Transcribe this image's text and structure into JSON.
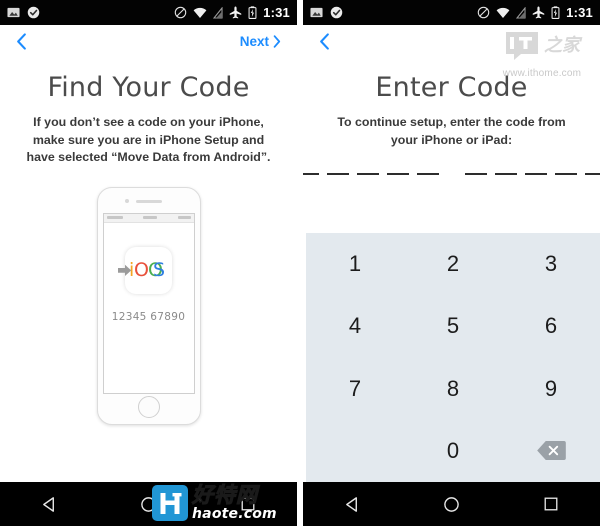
{
  "statusbar": {
    "time": "1:31",
    "icons_left": [
      "image-icon",
      "check-badge-icon"
    ],
    "icons_right": [
      "do-not-disturb-icon",
      "wifi-icon",
      "signal-off-icon",
      "airplane-mode-icon",
      "battery-icon"
    ]
  },
  "left_panel": {
    "nav": {
      "back_icon": "chevron-left-icon",
      "next_label": "Next",
      "next_icon": "chevron-right-icon"
    },
    "title": "Find Your Code",
    "subtitle": "If you don’t see a code on your iPhone, make sure you are in iPhone Setup and have selected “Move Data from Android”.",
    "phone": {
      "app_icon_label": "iOS",
      "arrow_icon": "right-arrow-icon",
      "code": "12345 67890"
    }
  },
  "right_panel": {
    "nav": {
      "back_icon": "chevron-left-icon"
    },
    "title": "Enter Code",
    "subtitle": "To continue setup, enter the code from your iPhone or iPad:",
    "code_field": {
      "group_one_slots": 5,
      "group_two_slots": 5,
      "entered_value": ""
    },
    "keypad": {
      "keys": [
        "1",
        "2",
        "3",
        "4",
        "5",
        "6",
        "7",
        "8",
        "9",
        "",
        "0",
        "delete"
      ],
      "delete_icon": "backspace-icon",
      "background_color": "#e3e9ee"
    }
  },
  "navbar": {
    "back_icon": "triangle-back-icon",
    "home_icon": "circle-home-icon",
    "recents_icon": "square-recents-icon"
  },
  "watermarks": {
    "ithome": {
      "logo_text": "IT",
      "logo_cn": "之家",
      "url": "www.ithome.com"
    },
    "haote": {
      "logo_letter": "H",
      "cn": "好特网",
      "url": "haote.com",
      "accent_color": "#2196d5"
    }
  },
  "colors": {
    "accent_blue": "#1c8cff",
    "keypad_bg": "#e3e9ee",
    "statusbar_bg": "#030303",
    "navbar_bg": "#000000"
  }
}
